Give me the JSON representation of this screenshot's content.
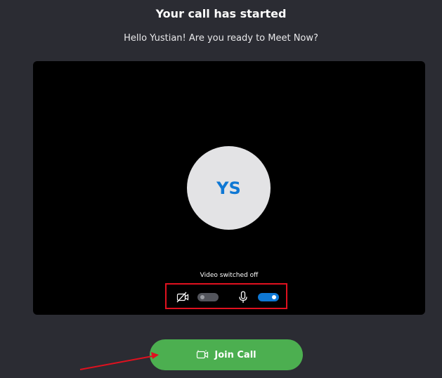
{
  "header": {
    "title": "Your call has started",
    "subtitle": "Hello Yustian! Are you ready to Meet Now?"
  },
  "preview": {
    "avatar_initials": "YS",
    "status_text": "Video switched off"
  },
  "controls": {
    "camera_icon": "video-off-icon",
    "camera_enabled": false,
    "mic_icon": "microphone-icon",
    "mic_enabled": true
  },
  "join": {
    "icon": "video-camera-icon",
    "label": "Join Call"
  },
  "colors": {
    "background": "#2b2c33",
    "preview_bg": "#000000",
    "accent": "#0f78d4",
    "join_green": "#4caf50",
    "highlight_red": "#e0111f"
  }
}
